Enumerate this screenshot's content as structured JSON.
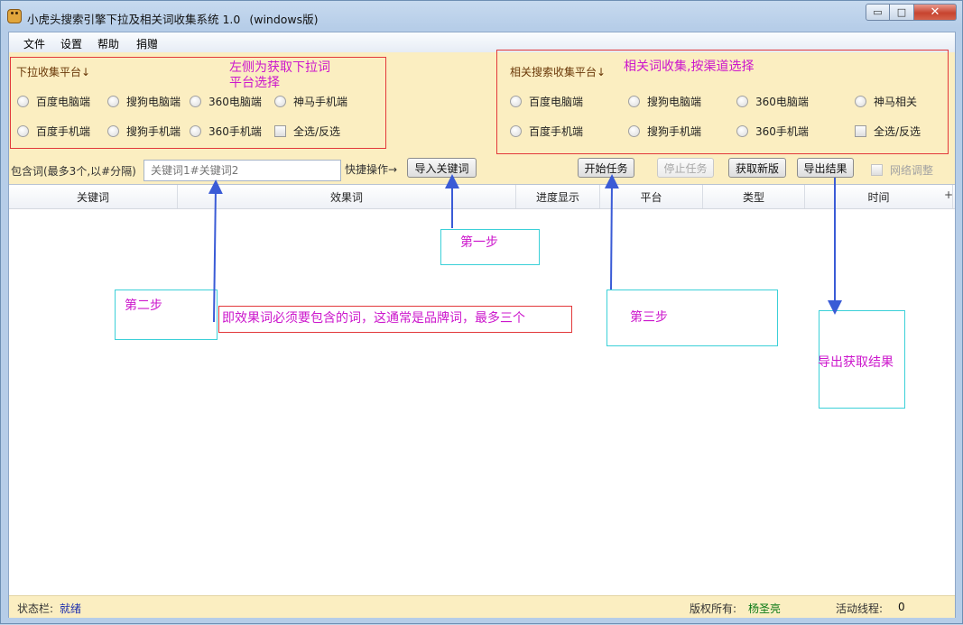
{
  "window": {
    "title": "小虎头搜索引擎下拉及相关词收集系统 1.0",
    "title_suffix": "(windows版)",
    "min_glyph": "▭",
    "max_glyph": "□",
    "close_glyph": "✕"
  },
  "menu": [
    "文件",
    "设置",
    "帮助",
    "捐赠"
  ],
  "dropdown_group": {
    "label": "下拉收集平台↓",
    "options_row1": [
      "百度电脑端",
      "搜狗电脑端",
      "360电脑端",
      "神马手机端"
    ],
    "options_row2": [
      "百度手机端",
      "搜狗手机端",
      "360手机端"
    ],
    "select_all": "全选/反选"
  },
  "related_group": {
    "label": "相关搜索收集平台↓",
    "options_row1": [
      "百度电脑端",
      "搜狗电脑端",
      "360电脑端",
      "神马相关"
    ],
    "options_row2": [
      "百度手机端",
      "搜狗手机端",
      "360手机端"
    ],
    "select_all": "全选/反选"
  },
  "toolbar": {
    "include_label": "包含词(最多3个,以#分隔)",
    "include_placeholder": "关键词1#关键词2",
    "quick_label": "快捷操作→",
    "import_btn": "导入关键词",
    "start_btn": "开始任务",
    "stop_btn": "停止任务",
    "fetch_btn": "获取新版",
    "export_btn": "导出结果",
    "network_adjust": "网络调整"
  },
  "table": {
    "columns": [
      "关键词",
      "效果词",
      "进度显示",
      "平台",
      "类型",
      "时间"
    ],
    "plus": "+"
  },
  "annotations": {
    "left_note_line1": "左侧为获取下拉词",
    "left_note_line2": "平台选择",
    "right_note": "相关词收集,按渠道选择",
    "step1": "第一步",
    "step2": "第二步",
    "step2_desc": "即效果词必须要包含的词，这通常是品牌词，最多三个",
    "step3": "第三步",
    "export_note": "导出获取结果"
  },
  "status": {
    "label": "状态栏:",
    "value": "就绪",
    "copyright_label": "版权所有:",
    "author": "杨圣亮",
    "threads_label": "活动线程:",
    "threads_value": "0"
  },
  "colors": {
    "panel_bg": "#fbeec1",
    "annotation_text": "#cc17cc",
    "annotation_red_box": "#e2383a",
    "annotation_cyan_box": "#3bd0d8",
    "arrow": "#3a5bd6"
  }
}
